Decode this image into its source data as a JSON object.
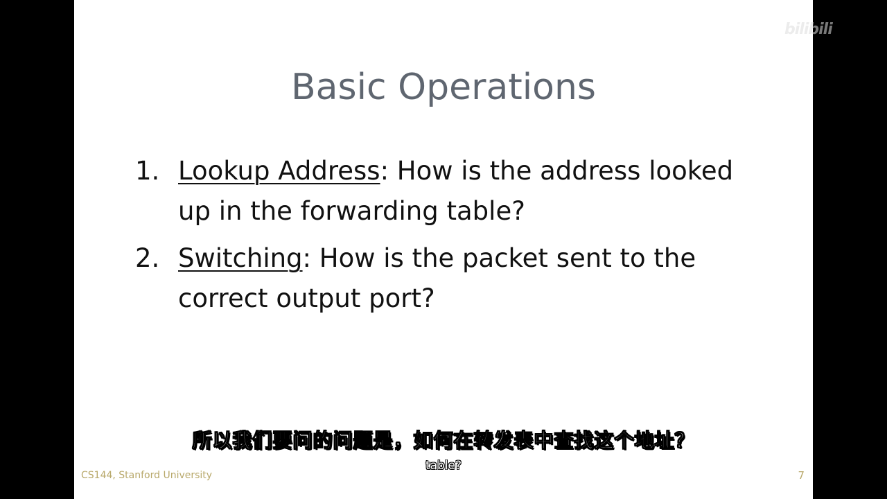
{
  "slide": {
    "title": "Basic Operations",
    "items": [
      {
        "number": "1.",
        "term": "Lookup Address",
        "rest": ": How is the address looked up in the forwarding table?"
      },
      {
        "number": "2.",
        "term": "Switching",
        "rest": ": How is the packet sent to the correct output port?"
      }
    ],
    "footer": "CS144, Stanford University",
    "page_number": "7"
  },
  "subtitles": {
    "chinese": "所以我们要问的问题是，如何在转发表中查找这个地址？",
    "english": "table?"
  },
  "watermark": "bilibili",
  "colors": {
    "title": "#5f6670",
    "body": "#111111",
    "footer": "#b8a86a",
    "background": "#000000",
    "slide": "#ffffff"
  }
}
